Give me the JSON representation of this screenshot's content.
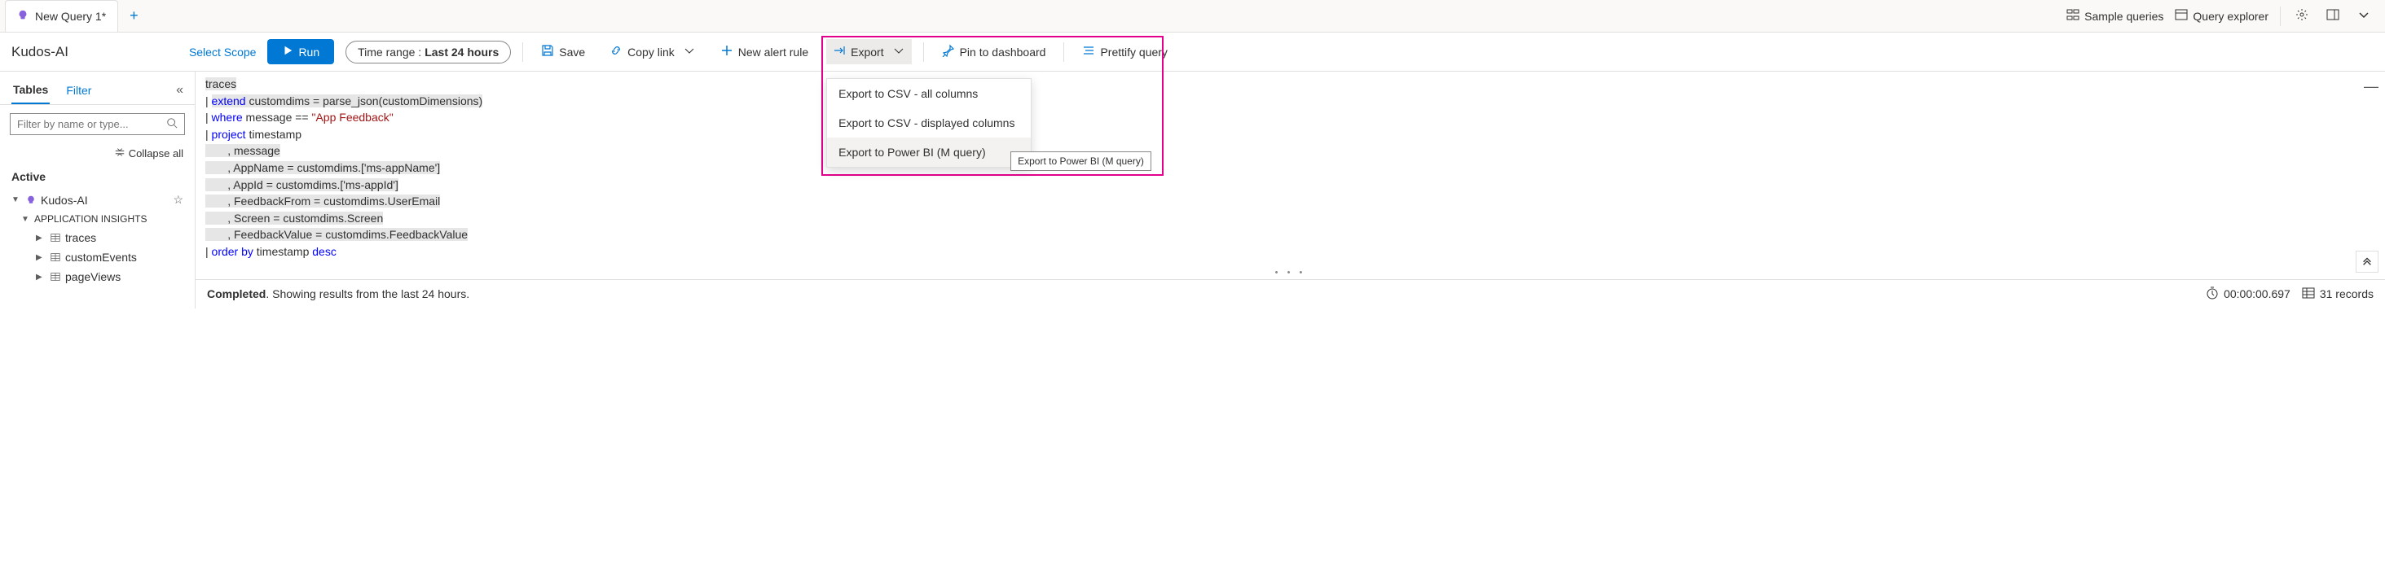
{
  "tabs": {
    "active": {
      "label": "New Query 1*"
    }
  },
  "tabbar_actions": {
    "sample_queries": "Sample queries",
    "query_explorer": "Query explorer"
  },
  "toolbar": {
    "scope_name": "Kudos-AI",
    "select_scope": "Select Scope",
    "run": "Run",
    "time_range_label": "Time range :",
    "time_range_value": "Last 24 hours",
    "save": "Save",
    "copy_link": "Copy link",
    "new_alert_rule": "New alert rule",
    "export": "Export",
    "pin": "Pin to dashboard",
    "prettify": "Prettify query"
  },
  "export_menu": {
    "items": [
      "Export to CSV - all columns",
      "Export to CSV - displayed columns",
      "Export to Power BI (M query)"
    ],
    "tooltip": "Export to Power BI (M query)"
  },
  "sidebar": {
    "tabs": {
      "tables": "Tables",
      "filter": "Filter"
    },
    "search_placeholder": "Filter by name or type...",
    "collapse_all": "Collapse all",
    "active_label": "Active",
    "tree": {
      "root": "Kudos-AI",
      "group": "APPLICATION INSIGHTS",
      "items": [
        "traces",
        "customEvents",
        "pageViews"
      ]
    }
  },
  "query": {
    "l1": "traces",
    "l2a": "extend",
    "l2b": " customdims = parse_json(customDimensions)",
    "l3a": "where",
    "l3b": " message == ",
    "l3c": "\"App Feedback\"",
    "l4a": "project",
    "l4b": " timestamp",
    "l5": "       , message",
    "l6": "       , AppName = customdims.['ms-appName']",
    "l7": "       , AppId = customdims.['ms-appId']",
    "l8": "       , FeedbackFrom = customdims.UserEmail",
    "l9": "       , Screen = customdims.Screen",
    "l10": "       , FeedbackValue = customdims.FeedbackValue",
    "l11a": "order by",
    "l11b": " timestamp ",
    "l11c": "desc"
  },
  "status": {
    "completed": "Completed",
    "message": ". Showing results from the last 24 hours.",
    "duration": "00:00:00.697",
    "records": "31 records"
  }
}
